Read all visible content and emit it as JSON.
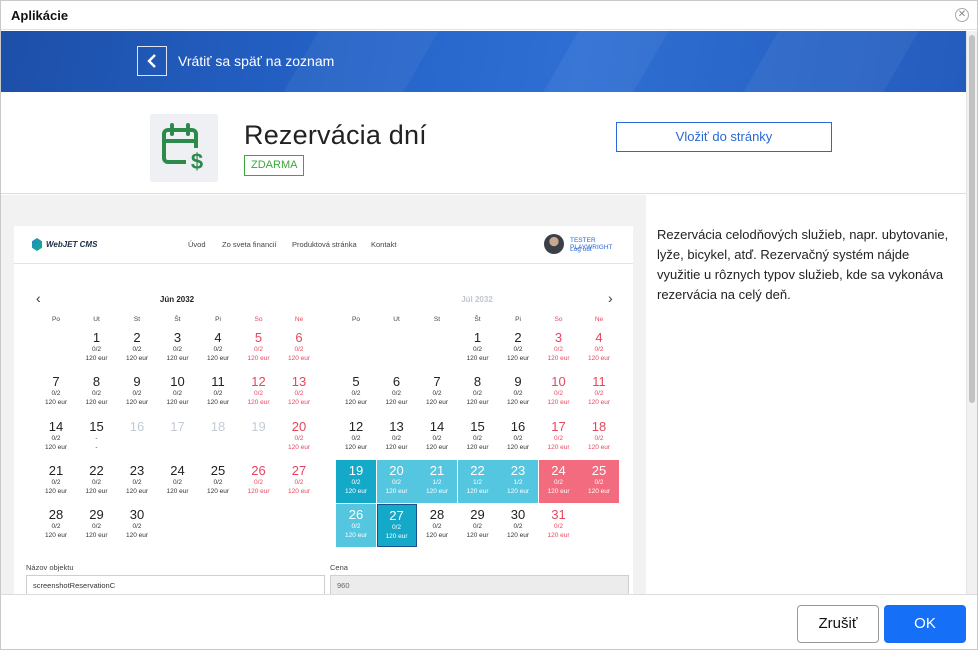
{
  "window": {
    "title": "Aplikácie"
  },
  "banner": {
    "back_label": "Vrátiť sa späť na zoznam"
  },
  "app": {
    "title": "Rezervácia dní",
    "badge": "ZDARMA",
    "insert_button": "Vložiť do stránky",
    "description": "Rezervácia celodňových služieb, napr. ubytovanie, lyže, bicykel, atď. Rezervačný systém nájde využitie u rôznych typov služieb, kde sa vykonáva rezervácia na celý deň.",
    "icon_color": "#2c8a4b"
  },
  "preview": {
    "logo": "WebJET CMS",
    "nav": [
      "Úvod",
      "Zo sveta financií",
      "Produktová stránka",
      "Kontakt"
    ],
    "user_name": "TESTER PLAYWRIGHT",
    "user_logout": "Log out",
    "weekdays": [
      "Po",
      "Ut",
      "St",
      "Št",
      "Pi",
      "So",
      "Ne"
    ],
    "month_left": "Jún 2032",
    "month_right": "Júl 2032",
    "june": [
      {
        "d": "1",
        "o": "0/2",
        "p": "120 eur"
      },
      {
        "d": "2",
        "o": "0/2",
        "p": "120 eur"
      },
      {
        "d": "3",
        "o": "0/2",
        "p": "120 eur"
      },
      {
        "d": "4",
        "o": "0/2",
        "p": "120 eur"
      },
      {
        "d": "5",
        "o": "0/2",
        "p": "120 eur"
      },
      {
        "d": "6",
        "o": "0/2",
        "p": "120 eur"
      },
      {
        "d": "7",
        "o": "0/2",
        "p": "120 eur"
      },
      {
        "d": "8",
        "o": "0/2",
        "p": "120 eur"
      },
      {
        "d": "9",
        "o": "0/2",
        "p": "120 eur"
      },
      {
        "d": "10",
        "o": "0/2",
        "p": "120 eur"
      },
      {
        "d": "11",
        "o": "0/2",
        "p": "120 eur"
      },
      {
        "d": "12",
        "o": "0/2",
        "p": "120 eur"
      },
      {
        "d": "13",
        "o": "0/2",
        "p": "120 eur"
      },
      {
        "d": "14",
        "o": "0/2",
        "p": "120 eur"
      },
      {
        "d": "15",
        "o": "-",
        "p": "-"
      },
      {
        "d": "16",
        "o": "",
        "p": ""
      },
      {
        "d": "17",
        "o": "",
        "p": ""
      },
      {
        "d": "18",
        "o": "",
        "p": ""
      },
      {
        "d": "19",
        "o": "",
        "p": ""
      },
      {
        "d": "20",
        "o": "0/2",
        "p": "120 eur"
      },
      {
        "d": "21",
        "o": "0/2",
        "p": "120 eur"
      },
      {
        "d": "22",
        "o": "0/2",
        "p": "120 eur"
      },
      {
        "d": "23",
        "o": "0/2",
        "p": "120 eur"
      },
      {
        "d": "24",
        "o": "0/2",
        "p": "120 eur"
      },
      {
        "d": "25",
        "o": "0/2",
        "p": "120 eur"
      },
      {
        "d": "26",
        "o": "0/2",
        "p": "120 eur"
      },
      {
        "d": "27",
        "o": "0/2",
        "p": "120 eur"
      },
      {
        "d": "28",
        "o": "0/2",
        "p": "120 eur"
      },
      {
        "d": "29",
        "o": "0/2",
        "p": "120 eur"
      },
      {
        "d": "30",
        "o": "0/2",
        "p": "120 eur"
      }
    ],
    "july": [
      {
        "d": "1",
        "o": "0/2",
        "p": "120 eur"
      },
      {
        "d": "2",
        "o": "0/2",
        "p": "120 eur"
      },
      {
        "d": "3",
        "o": "0/2",
        "p": "120 eur"
      },
      {
        "d": "4",
        "o": "0/2",
        "p": "120 eur"
      },
      {
        "d": "5",
        "o": "0/2",
        "p": "120 eur"
      },
      {
        "d": "6",
        "o": "0/2",
        "p": "120 eur"
      },
      {
        "d": "7",
        "o": "0/2",
        "p": "120 eur"
      },
      {
        "d": "8",
        "o": "0/2",
        "p": "120 eur"
      },
      {
        "d": "9",
        "o": "0/2",
        "p": "120 eur"
      },
      {
        "d": "10",
        "o": "0/2",
        "p": "120 eur"
      },
      {
        "d": "11",
        "o": "0/2",
        "p": "120 eur"
      },
      {
        "d": "12",
        "o": "0/2",
        "p": "120 eur"
      },
      {
        "d": "13",
        "o": "0/2",
        "p": "120 eur"
      },
      {
        "d": "14",
        "o": "0/2",
        "p": "120 eur"
      },
      {
        "d": "15",
        "o": "0/2",
        "p": "120 eur"
      },
      {
        "d": "16",
        "o": "0/2",
        "p": "120 eur"
      },
      {
        "d": "17",
        "o": "0/2",
        "p": "120 eur"
      },
      {
        "d": "18",
        "o": "0/2",
        "p": "120 eur"
      },
      {
        "d": "19",
        "o": "0/2",
        "p": "120 eur"
      },
      {
        "d": "20",
        "o": "0/2",
        "p": "120 eur"
      },
      {
        "d": "21",
        "o": "1/2",
        "p": "120 eur"
      },
      {
        "d": "22",
        "o": "1/2",
        "p": "120 eur"
      },
      {
        "d": "23",
        "o": "1/2",
        "p": "120 eur"
      },
      {
        "d": "24",
        "o": "0/2",
        "p": "120 eur"
      },
      {
        "d": "25",
        "o": "0/2",
        "p": "120 eur"
      },
      {
        "d": "26",
        "o": "0/2",
        "p": "120 eur"
      },
      {
        "d": "27",
        "o": "0/2",
        "p": "120 eur"
      },
      {
        "d": "28",
        "o": "0/2",
        "p": "120 eur"
      },
      {
        "d": "29",
        "o": "0/2",
        "p": "120 eur"
      },
      {
        "d": "30",
        "o": "0/2",
        "p": "120 eur"
      },
      {
        "d": "31",
        "o": "0/2",
        "p": "120 eur"
      }
    ],
    "object_label": "Názov objektu",
    "object_value": "screenshotReservationC",
    "price_label": "Cena",
    "price_value": "960"
  },
  "footer": {
    "cancel": "Zrušiť",
    "ok": "OK"
  },
  "colors": {
    "primary": "#1670f7",
    "banner": "#2462c7",
    "badge": "#3aa83a",
    "selected": "#54c6e0",
    "weekend": "#e8465f"
  }
}
